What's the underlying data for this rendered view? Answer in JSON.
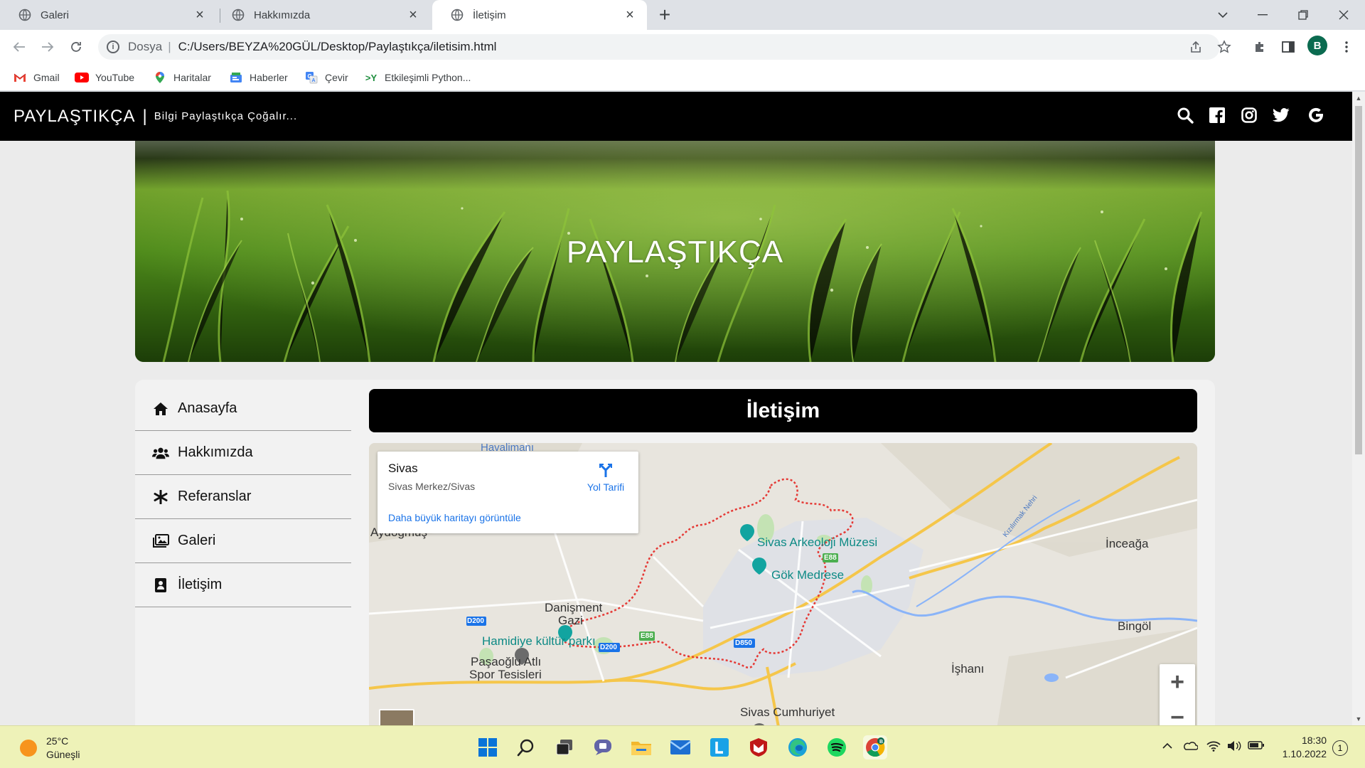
{
  "browser": {
    "tabs": [
      {
        "title": "Galeri",
        "active": false
      },
      {
        "title": "Hakkımızda",
        "active": false
      },
      {
        "title": "İletişim",
        "active": true
      }
    ],
    "omnibox": {
      "scheme_label": "Dosya",
      "url": "C:/Users/BEYZA%20GÜL/Desktop/Paylaştıkça/iletisim.html"
    },
    "profile_initial": "B",
    "bookmarks": [
      {
        "label": "Gmail",
        "icon": "gmail-icon"
      },
      {
        "label": "YouTube",
        "icon": "youtube-icon"
      },
      {
        "label": "Haritalar",
        "icon": "maps-icon"
      },
      {
        "label": "Haberler",
        "icon": "news-icon"
      },
      {
        "label": "Çevir",
        "icon": "translate-icon"
      },
      {
        "label": "Etkileşimli Python...",
        "icon": "python-icon"
      }
    ]
  },
  "site": {
    "brand": "PAYLAŞTIKÇA",
    "separator": "|",
    "tagline": "Bilgi Paylaştıkça Çoğalır...",
    "social_icons": [
      "search-icon",
      "facebook-icon",
      "instagram-icon",
      "twitter-icon",
      "google-icon"
    ],
    "hero_title": "PAYLAŞTIKÇA",
    "menu": [
      {
        "label": "Anasayfa",
        "icon": "home-icon"
      },
      {
        "label": "Hakkımızda",
        "icon": "users-icon"
      },
      {
        "label": "Referanslar",
        "icon": "asterisk-icon"
      },
      {
        "label": "Galeri",
        "icon": "gallery-icon"
      },
      {
        "label": "İletişim",
        "icon": "contact-icon"
      }
    ],
    "page_heading": "İletişim"
  },
  "map": {
    "place_title": "Sivas",
    "place_address": "Sivas Merkez/Sivas",
    "directions_label": "Yol Tarifi",
    "larger_map_link": "Daha büyük haritayı görüntüle",
    "labels": {
      "aydogmus": "Aydoğmuş",
      "museum": "Sivas Arkeoloji Müzesi",
      "medrese": "Gök Medrese",
      "danisment": "Danişment",
      "gazi": "Gazi",
      "park": "Hamidiye kültür parkı",
      "pasaoglu1": "Paşaoğlu Atlı",
      "pasaoglu2": "Spor Tesisleri",
      "university": "Sivas Cumhuriyet",
      "incaga": "İnceağa",
      "bingol": "Bingöl",
      "ishani": "İşhanı",
      "river": "Kızılırmak Nehri",
      "airport": "Havalimanı",
      "road_d200a": "D200",
      "road_d200b": "D200",
      "road_e88a": "E88",
      "road_e88b": "E88",
      "road_d850": "D850"
    },
    "zoom_in": "+",
    "zoom_out": "−"
  },
  "taskbar": {
    "temperature": "25°C",
    "weather": "Güneşli",
    "time": "18:30",
    "date": "1.10.2022",
    "notification_count": "1"
  },
  "colors": {
    "header_bg": "#000000",
    "link_blue": "#1a73e8",
    "poi_teal": "#0d8a85",
    "city_boundary": "#e53935",
    "taskbar_bg": "#eef2b8"
  }
}
